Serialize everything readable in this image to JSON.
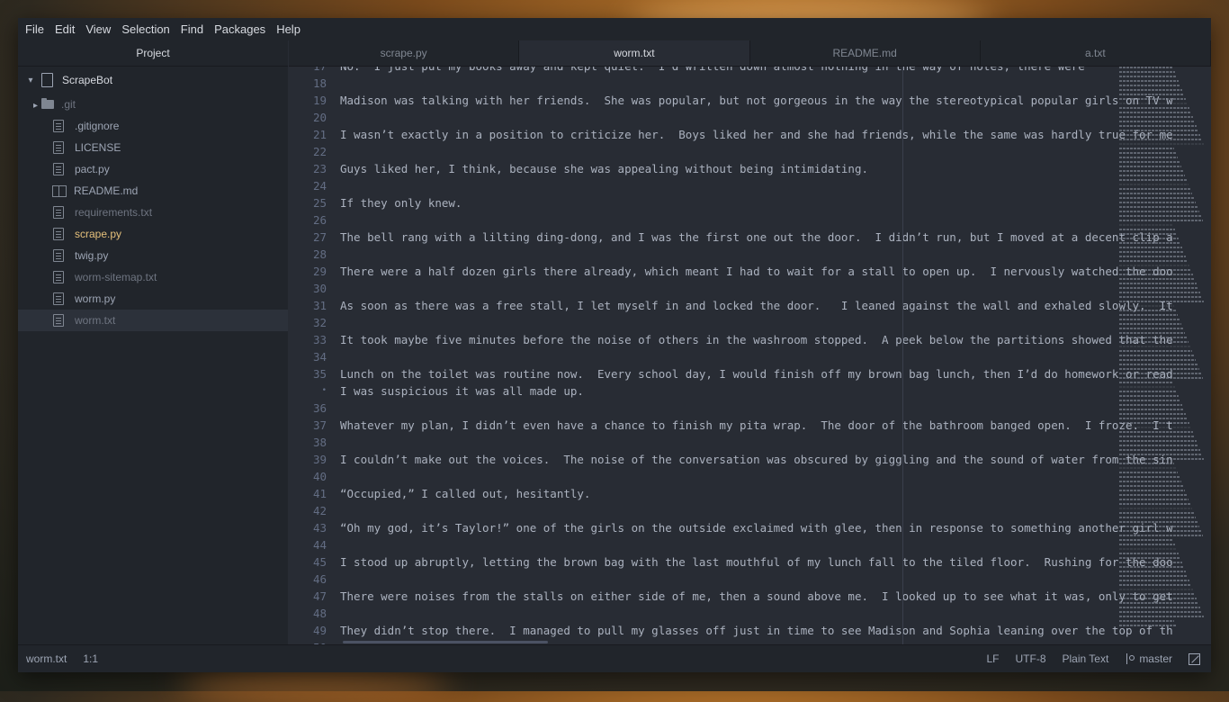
{
  "menu": [
    "File",
    "Edit",
    "View",
    "Selection",
    "Find",
    "Packages",
    "Help"
  ],
  "sidebar": {
    "title": "Project",
    "root": "ScrapeBot",
    "items": [
      {
        "label": ".git",
        "kind": "folder",
        "state": "muted"
      },
      {
        "label": ".gitignore",
        "kind": "file",
        "state": "normal"
      },
      {
        "label": "LICENSE",
        "kind": "file",
        "state": "normal"
      },
      {
        "label": "pact.py",
        "kind": "file",
        "state": "normal"
      },
      {
        "label": "README.md",
        "kind": "book",
        "state": "normal"
      },
      {
        "label": "requirements.txt",
        "kind": "file",
        "state": "muted"
      },
      {
        "label": "scrape.py",
        "kind": "file",
        "state": "modified"
      },
      {
        "label": "twig.py",
        "kind": "file",
        "state": "normal"
      },
      {
        "label": "worm-sitemap.txt",
        "kind": "file",
        "state": "muted"
      },
      {
        "label": "worm.py",
        "kind": "file",
        "state": "normal"
      },
      {
        "label": "worm.txt",
        "kind": "file",
        "state": "selected"
      }
    ]
  },
  "tabs": [
    {
      "label": "scrape.py",
      "active": false
    },
    {
      "label": "worm.txt",
      "active": true
    },
    {
      "label": "README.md",
      "active": false
    },
    {
      "label": "a.txt",
      "active": false
    }
  ],
  "code": [
    {
      "n": "17",
      "t": "No.  I just put my books away and kept quiet.  I’d written down almost nothing in the way of notes, there were"
    },
    {
      "n": "18",
      "t": ""
    },
    {
      "n": "19",
      "t": "Madison was talking with her friends.  She was popular, but not gorgeous in the way the stereotypical popular girls on TV w"
    },
    {
      "n": "20",
      "t": ""
    },
    {
      "n": "21",
      "t": "I wasn’t exactly in a position to criticize her.  Boys liked her and she had friends, while the same was hardly true for me"
    },
    {
      "n": "22",
      "t": ""
    },
    {
      "n": "23",
      "t": "Guys liked her, I think, because she was appealing without being intimidating."
    },
    {
      "n": "24",
      "t": ""
    },
    {
      "n": "25",
      "t": "If they only knew."
    },
    {
      "n": "26",
      "t": ""
    },
    {
      "n": "27",
      "t": "The bell rang with a lilting ding-dong, and I was the first one out the door.  I didn’t run, but I moved at a decent clip a"
    },
    {
      "n": "28",
      "t": ""
    },
    {
      "n": "29",
      "t": "There were a half dozen girls there already, which meant I had to wait for a stall to open up.  I nervously watched the doo"
    },
    {
      "n": "30",
      "t": ""
    },
    {
      "n": "31",
      "t": "As soon as there was a free stall, I let myself in and locked the door.   I leaned against the wall and exhaled slowly.  It"
    },
    {
      "n": "32",
      "t": ""
    },
    {
      "n": "33",
      "t": "It took maybe five minutes before the noise of others in the washroom stopped.  A peek below the partitions showed that the"
    },
    {
      "n": "34",
      "t": ""
    },
    {
      "n": "35",
      "t": "Lunch on the toilet was routine now.  Every school day, I would finish off my brown bag lunch, then I’d do homework or read"
    },
    {
      "n": "•",
      "t": "I was suspicious it was all made up."
    },
    {
      "n": "36",
      "t": ""
    },
    {
      "n": "37",
      "t": "Whatever my plan, I didn’t even have a chance to finish my pita wrap.  The door of the bathroom banged open.  I froze.  I t"
    },
    {
      "n": "38",
      "t": ""
    },
    {
      "n": "39",
      "t": "I couldn’t make out the voices.  The noise of the conversation was obscured by giggling and the sound of water from the sin"
    },
    {
      "n": "40",
      "t": ""
    },
    {
      "n": "41",
      "t": "“Occupied,” I called out, hesitantly."
    },
    {
      "n": "42",
      "t": ""
    },
    {
      "n": "43",
      "t": "“Oh my god, it’s Taylor!” one of the girls on the outside exclaimed with glee, then in response to something another girl w"
    },
    {
      "n": "44",
      "t": ""
    },
    {
      "n": "45",
      "t": "I stood up abruptly, letting the brown bag with the last mouthful of my lunch fall to the tiled floor.  Rushing for the doo"
    },
    {
      "n": "46",
      "t": ""
    },
    {
      "n": "47",
      "t": "There were noises from the stalls on either side of me, then a sound above me.  I looked up to see what it was, only to get"
    },
    {
      "n": "48",
      "t": ""
    },
    {
      "n": "49",
      "t": "They didn’t stop there.  I managed to pull my glasses off just in time to see Madison and Sophia leaning over the top of th"
    },
    {
      "n": "50",
      "t": ""
    }
  ],
  "status": {
    "file": "worm.txt",
    "cursor": "1:1",
    "line_ending": "LF",
    "encoding": "UTF-8",
    "grammar": "Plain Text",
    "branch": "master"
  },
  "colors": {
    "editor_bg": "#282c34",
    "panel_bg": "#21252b",
    "modified": "#e5c07b",
    "text": "#abb2bf"
  }
}
